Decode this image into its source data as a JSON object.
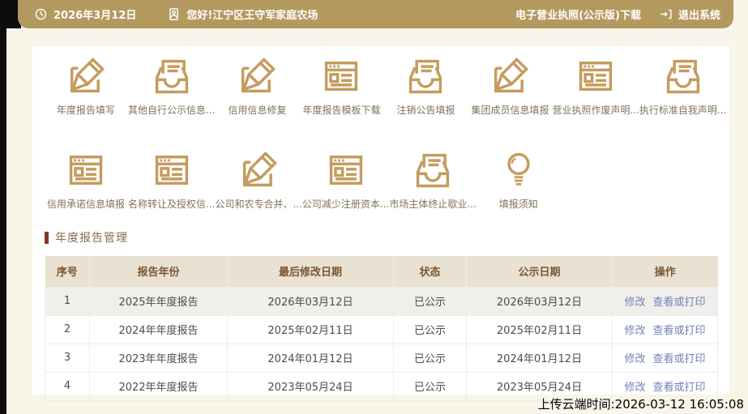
{
  "topbar": {
    "date": "2026年3月12日",
    "greeting": "您好!江宁区王守军家庭农场",
    "license_download": "电子营业执照(公示版)下载",
    "logout": "退出系统"
  },
  "icon_grid": {
    "row1": [
      {
        "label": "年度报告填写",
        "icon": "edit-icon"
      },
      {
        "label": "其他自行公示信息...",
        "icon": "inbox-icon"
      },
      {
        "label": "信用信息修复",
        "icon": "edit-icon"
      },
      {
        "label": "年度报告模板下载",
        "icon": "browser-icon"
      },
      {
        "label": "注销公告填报",
        "icon": "inbox-icon"
      },
      {
        "label": "集团成员信息填报",
        "icon": "edit-icon"
      },
      {
        "label": "营业执照作废声明...",
        "icon": "browser-icon"
      },
      {
        "label": "执行标准自我声明...",
        "icon": "inbox-icon"
      }
    ],
    "row2": [
      {
        "label": "信用承诺信息填报",
        "icon": "browser-icon"
      },
      {
        "label": "名称转让及授权信...",
        "icon": "browser-icon"
      },
      {
        "label": "公司和农专合并、...",
        "icon": "edit-icon"
      },
      {
        "label": "公司减少注册资本...",
        "icon": "browser-icon"
      },
      {
        "label": "市场主体终止歇业...",
        "icon": "inbox-icon"
      },
      {
        "label": "填报须知",
        "icon": "bulb-icon"
      }
    ]
  },
  "section": {
    "title": "年度报告管理"
  },
  "table": {
    "headers": [
      "序号",
      "报告年份",
      "最后修改日期",
      "状态",
      "公示日期",
      "操作"
    ],
    "rows": [
      {
        "no": "1",
        "year": "2025年年度报告",
        "modified": "2026年03月12日",
        "status": "已公示",
        "published": "2026年03月12日",
        "actions": [
          "修改",
          "查看或打印"
        ]
      },
      {
        "no": "2",
        "year": "2024年年度报告",
        "modified": "2025年02月11日",
        "status": "已公示",
        "published": "2025年02月11日",
        "actions": [
          "修改",
          "查看或打印"
        ]
      },
      {
        "no": "3",
        "year": "2023年年度报告",
        "modified": "2024年01月12日",
        "status": "已公示",
        "published": "2024年01月12日",
        "actions": [
          "修改",
          "查看或打印"
        ]
      },
      {
        "no": "4",
        "year": "2022年年度报告",
        "modified": "2023年05月24日",
        "status": "已公示",
        "published": "2023年05月24日",
        "actions": [
          "修改",
          "查看或打印"
        ]
      }
    ]
  },
  "footer": {
    "upload_time": "上传云端时间:2026-03-12 16:05:08"
  },
  "colors": {
    "topbar_bg": "#b4995f",
    "page_bg": "#f9f5e9",
    "icon_gold": "#c49c5e",
    "section_bar": "#83392a",
    "header_bg": "#e9e1d1",
    "header_text": "#7a5632",
    "link_blue": "#7282b8",
    "edge_black": "#0d0d0d"
  }
}
